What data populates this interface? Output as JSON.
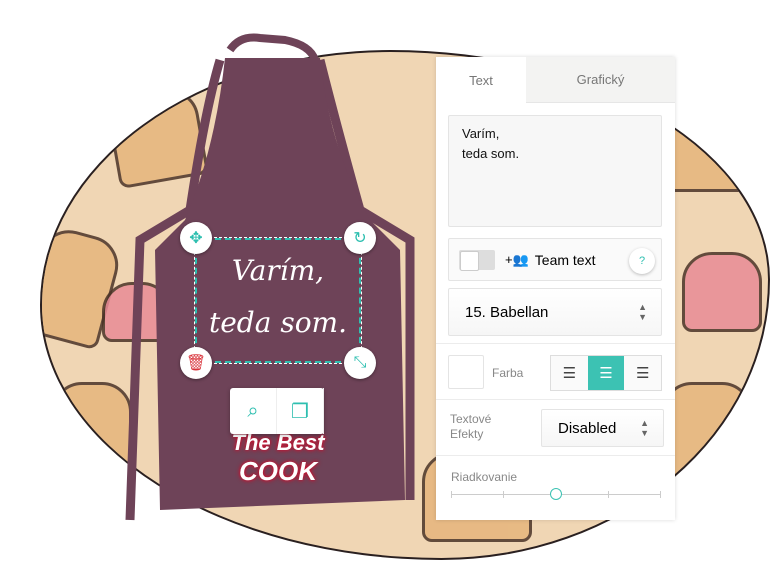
{
  "canvas": {
    "apron_text": "Varím,\nteda som.",
    "apron_color": "#6e4358",
    "accent": "#2ebfb0",
    "logo_text": "The Best COOK"
  },
  "panel": {
    "tabs": [
      {
        "label": "Text",
        "active": true
      },
      {
        "label": "Grafický",
        "active": false
      }
    ],
    "text_value": "Varím,\nteda som.",
    "team_text": {
      "label": "Team text",
      "enabled": false,
      "help": "?"
    },
    "font_select": "15. Babellan",
    "color_label": "Farba",
    "alignment": {
      "options": [
        "left",
        "center",
        "right"
      ],
      "selected": "center"
    },
    "effects_label": "Textové Efekty",
    "effects_select": "Disabled",
    "line_spacing_label": "Riadkovanie",
    "line_spacing_value": 0.5
  }
}
